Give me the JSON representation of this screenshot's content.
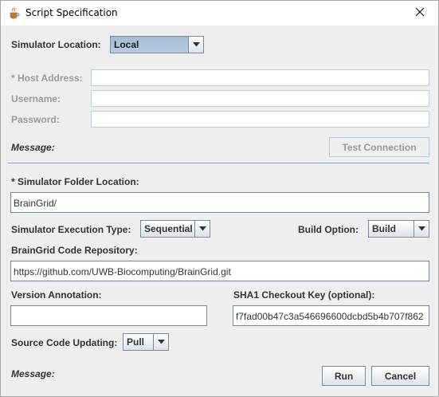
{
  "window": {
    "title": "Script Specification",
    "icon": "java-coffee-icon",
    "close_icon": "close-icon"
  },
  "simulator_location": {
    "label": "Simulator Location:",
    "value": "Local"
  },
  "host_address": {
    "label": "* Host Address:",
    "value": ""
  },
  "username": {
    "label": "Username:",
    "value": ""
  },
  "password": {
    "label": "Password:",
    "value": ""
  },
  "message_top": {
    "label": "Message:"
  },
  "test_connection": {
    "label": "Test Connection"
  },
  "simulator_folder": {
    "label": "* Simulator Folder Location:",
    "value": "BrainGrid/"
  },
  "execution_type": {
    "label": "Simulator Execution Type:",
    "value": "Sequential"
  },
  "build_option": {
    "label": "Build Option:",
    "value": "Build"
  },
  "code_repository": {
    "label": "BrainGrid Code Repository:",
    "value": "https://github.com/UWB-Biocomputing/BrainGrid.git"
  },
  "version_annotation": {
    "label": "Version Annotation:",
    "value": ""
  },
  "sha1_key": {
    "label": "SHA1 Checkout Key (optional):",
    "value": "f7fad00b47c3a546696600dcbd5b4b707f862"
  },
  "source_updating": {
    "label": "Source Code Updating:",
    "value": "Pull"
  },
  "message_bottom": {
    "label": "Message:"
  },
  "run_button": {
    "label": "Run"
  },
  "cancel_button": {
    "label": "Cancel"
  }
}
